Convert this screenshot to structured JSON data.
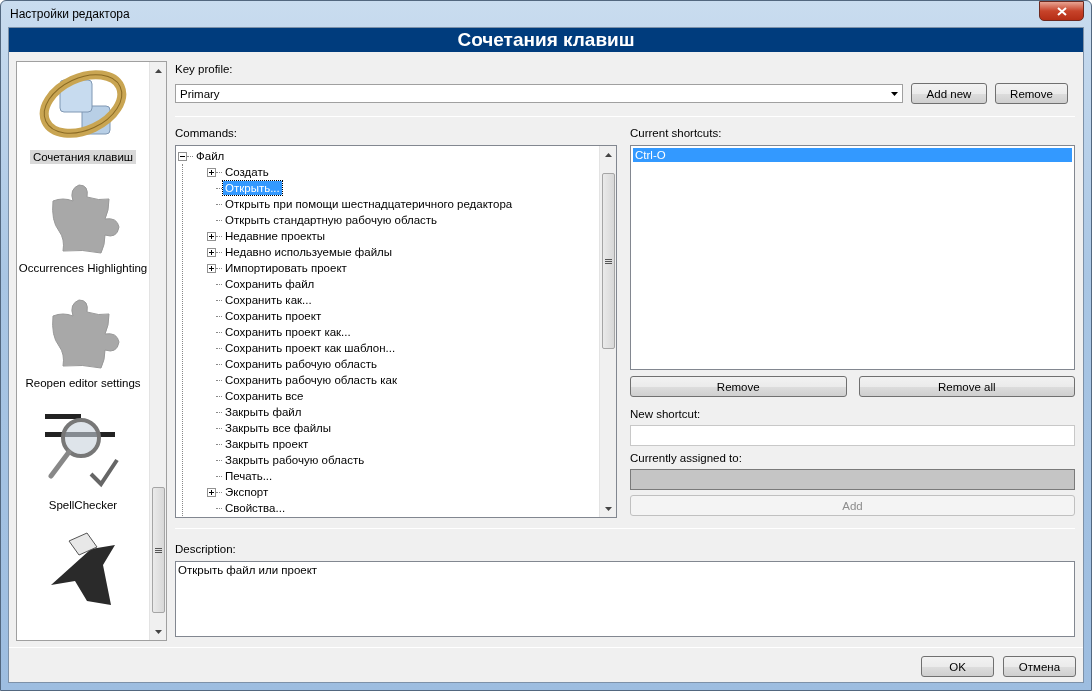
{
  "window": {
    "title": "Настройки редактора"
  },
  "header": "Сочетания клавиш",
  "sidebar": {
    "items": [
      {
        "kind": "keys",
        "label": "Сочетания клавиш",
        "selected": true
      },
      {
        "kind": "plugin",
        "label": "Occurrences Highlighting",
        "selected": false
      },
      {
        "kind": "plugin",
        "label": "Reopen editor settings",
        "selected": false
      },
      {
        "kind": "spell",
        "label": "SpellChecker",
        "selected": false
      },
      {
        "kind": "stand"
      }
    ]
  },
  "key_profile": {
    "label": "Key profile:",
    "value": "Primary",
    "buttons": [
      "Add new",
      "Remove"
    ]
  },
  "commands": {
    "label": "Commands:",
    "tree": [
      {
        "label": "Файл",
        "expanded": true,
        "selected": false,
        "children": [
          {
            "label": "Создать",
            "expanded": false,
            "selected": false
          },
          {
            "label": "Открыть...",
            "selected": true
          },
          {
            "label": "Открыть при помощи шестнадцатеричного редактора",
            "selected": false
          },
          {
            "label": "Открыть стандартную рабочую область",
            "selected": false
          },
          {
            "label": "Недавние проекты",
            "expanded": false,
            "selected": false
          },
          {
            "label": "Недавно используемые файлы",
            "expanded": false,
            "selected": false
          },
          {
            "label": "Импортировать проект",
            "expanded": false,
            "selected": false
          },
          {
            "label": "Сохранить файл",
            "selected": false
          },
          {
            "label": "Сохранить как...",
            "selected": false
          },
          {
            "label": "Сохранить проект",
            "selected": false
          },
          {
            "label": "Сохранить проект как...",
            "selected": false
          },
          {
            "label": "Сохранить проект как шаблон...",
            "selected": false
          },
          {
            "label": "Сохранить рабочую область",
            "selected": false
          },
          {
            "label": "Сохранить рабочую область как",
            "selected": false
          },
          {
            "label": "Сохранить все",
            "selected": false
          },
          {
            "label": "Закрыть файл",
            "selected": false
          },
          {
            "label": "Закрыть все файлы",
            "selected": false
          },
          {
            "label": "Закрыть проект",
            "selected": false
          },
          {
            "label": "Закрыть рабочую область",
            "selected": false
          },
          {
            "label": "Печать...",
            "selected": false
          },
          {
            "label": "Экспорт",
            "expanded": false,
            "selected": false
          },
          {
            "label": "Свойства...",
            "selected": false
          }
        ]
      }
    ]
  },
  "current_shortcuts": {
    "label": "Current shortcuts:",
    "items": [
      {
        "label": "Ctrl-O",
        "selected": true
      }
    ],
    "buttons": [
      {
        "label": "Remove",
        "disabled": false
      },
      {
        "label": "Remove all",
        "disabled": false
      }
    ]
  },
  "new_shortcut": {
    "label": "New shortcut:"
  },
  "currently_assigned": {
    "label": "Currently assigned to:"
  },
  "add_button": {
    "label": "Add",
    "disabled": true
  },
  "description": {
    "label": "Description:",
    "value": "Открыть файл или проект"
  },
  "buttons": [
    "OK",
    "Отмена"
  ]
}
